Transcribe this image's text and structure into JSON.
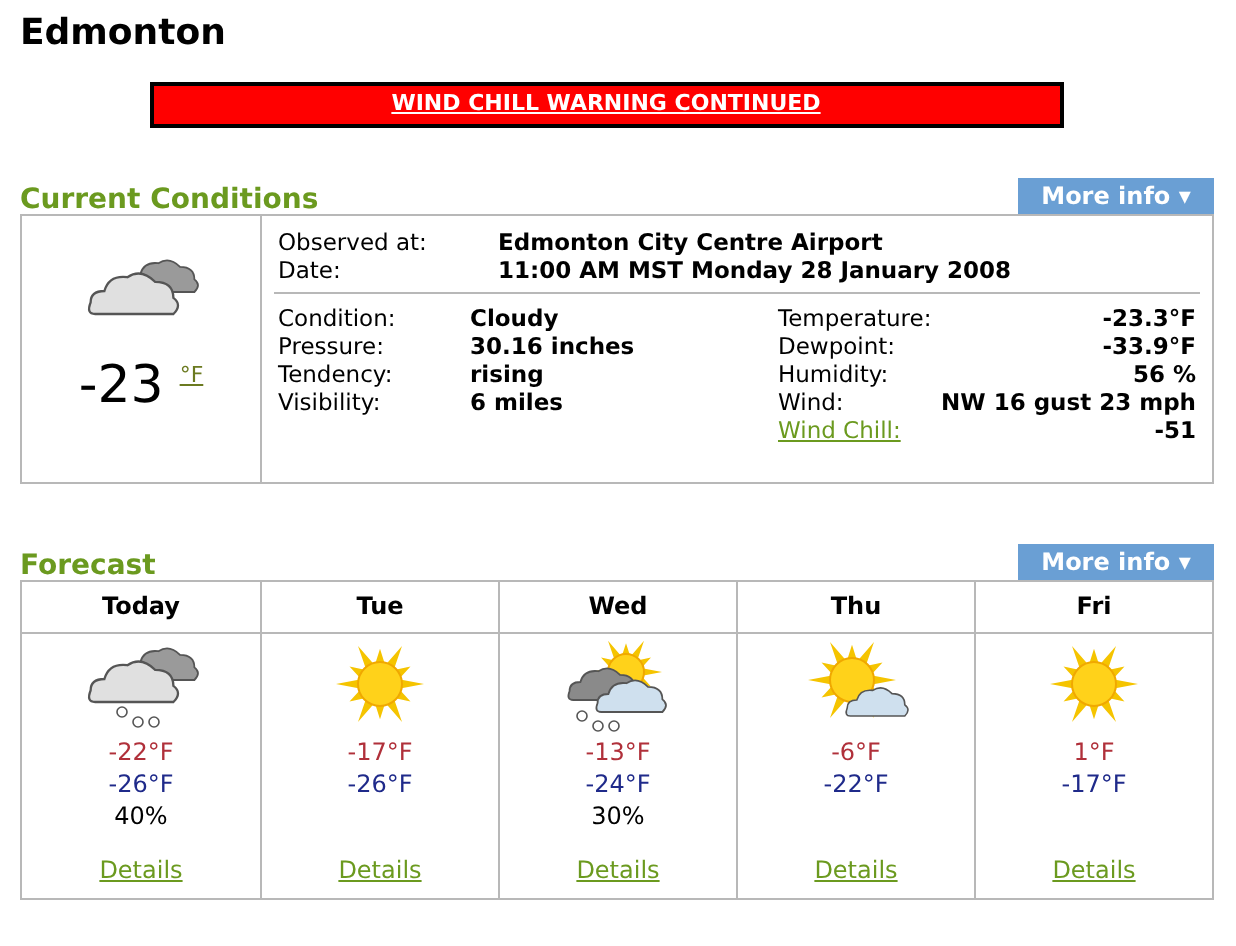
{
  "city": "Edmonton",
  "warning": "WIND CHILL WARNING CONTINUED",
  "current": {
    "heading": "Current Conditions",
    "more_info": "More info ▾",
    "kind": "cloudy",
    "temperature": "-23",
    "unit": "°F",
    "observed": [
      {
        "label": "Observed at:",
        "value": "Edmonton City Centre Airport"
      },
      {
        "label": "Date:",
        "value": "11:00 AM MST Monday 28 January 2008"
      }
    ],
    "left": [
      {
        "label": "Condition:",
        "value": "Cloudy"
      },
      {
        "label": "Pressure:",
        "value": "30.16 inches"
      },
      {
        "label": "Tendency:",
        "value": "rising"
      },
      {
        "label": "Visibility:",
        "value": "6 miles"
      }
    ],
    "right": [
      {
        "label": "Temperature:",
        "value": "-23.3°F",
        "link": false
      },
      {
        "label": "Dewpoint:",
        "value": "-33.9°F",
        "link": false
      },
      {
        "label": "Humidity:",
        "value": "56 %",
        "link": false
      },
      {
        "label": "Wind:",
        "value": "NW 16 gust 23 mph",
        "link": false
      },
      {
        "label": "Wind Chill:",
        "value": "-51",
        "link": true
      }
    ]
  },
  "forecast": {
    "heading": "Forecast",
    "more_info": "More info ▾",
    "days": [
      {
        "day": "Today",
        "kind": "cloud_snow",
        "high": "-22°F",
        "low": "-26°F",
        "pop": "40%",
        "details": "Details"
      },
      {
        "day": "Tue",
        "kind": "sun",
        "high": "-17°F",
        "low": "-26°F",
        "details": "Details"
      },
      {
        "day": "Wed",
        "kind": "sun_cloud_snow",
        "high": "-13°F",
        "low": "-24°F",
        "pop": "30%",
        "details": "Details"
      },
      {
        "day": "Thu",
        "kind": "sun_cloud",
        "high": "-6°F",
        "low": "-22°F",
        "details": "Details"
      },
      {
        "day": "Fri",
        "kind": "sun",
        "high": "1°F",
        "low": "-17°F",
        "details": "Details"
      }
    ]
  }
}
